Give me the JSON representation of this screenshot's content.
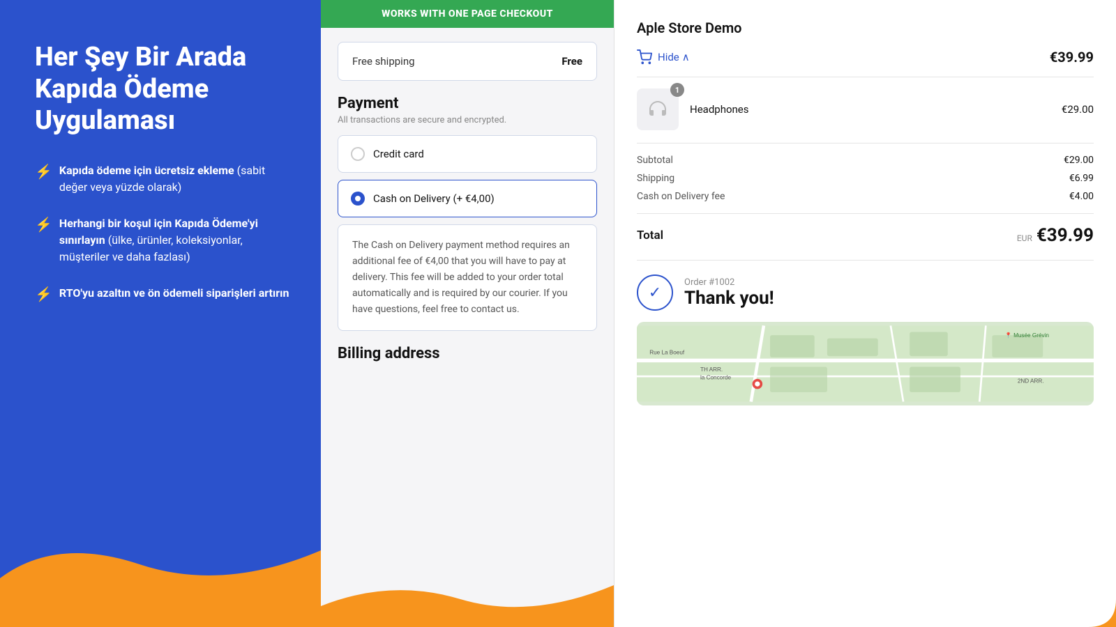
{
  "left": {
    "title": "Her Şey Bir Arada\nKapıda Ödeme\nUygulaması",
    "features": [
      {
        "bold": "Kapıda ödeme için ücretsiz ekleme",
        "rest": " (sabit değer veya yüzde olarak)"
      },
      {
        "bold": "Herhangi bir koşul için Kapıda Ödeme'yi sınırlayın",
        "rest": " (ülke, ürünler, koleksiyonlar, müşteriler ve daha fazlası)"
      },
      {
        "bold": "RTO'yu azaltın ve ön ödemeli siparişleri artırın",
        "rest": ""
      }
    ]
  },
  "middle": {
    "badge": "WORKS WITH ONE PAGE CHECKOUT",
    "shipping": {
      "label": "Free shipping",
      "price": "Free"
    },
    "payment": {
      "title": "Payment",
      "subtitle": "All transactions are secure and encrypted.",
      "options": [
        {
          "id": "credit",
          "label": "Credit card",
          "selected": false
        },
        {
          "id": "cod",
          "label": "Cash on Delivery (+ €4,00)",
          "selected": true
        }
      ],
      "cod_info": "The Cash on Delivery payment method requires an additional fee of €4,00 that you will have to pay at delivery. This fee will be added to your order total automatically and is required by our courier. If you have questions, feel free to contact us."
    },
    "billing": {
      "title": "Billing address"
    }
  },
  "right": {
    "store_name": "Aple Store Demo",
    "cart": {
      "hide_label": "Hide",
      "total": "€39.99"
    },
    "product": {
      "name": "Headphones",
      "price": "€29.00",
      "qty": "1"
    },
    "summary": {
      "subtotal_label": "Subtotal",
      "subtotal_val": "€29.00",
      "shipping_label": "Shipping",
      "shipping_val": "€6.99",
      "cod_label": "Cash on Delivery fee",
      "cod_val": "€4.00"
    },
    "total": {
      "label": "Total",
      "currency": "EUR",
      "amount": "€39.99"
    },
    "order": {
      "number": "Order #1002",
      "thankyou": "Thank you!"
    },
    "map": {
      "labels": [
        "Rue La Boeuf",
        "Musée Grévin",
        "TH ARR.",
        "la Concorde",
        "2ND ARR."
      ]
    }
  }
}
